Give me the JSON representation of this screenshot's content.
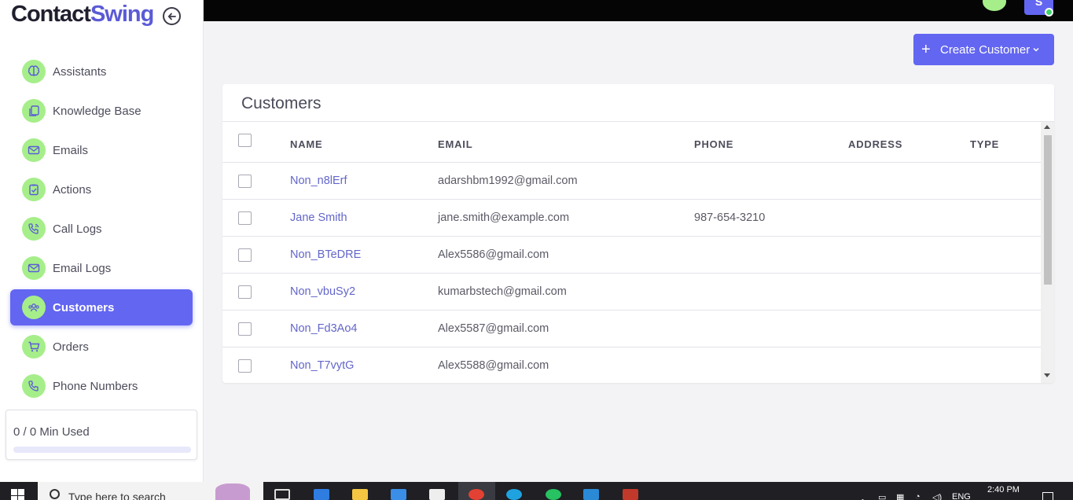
{
  "brand": {
    "part1": "Contact",
    "part2": "Swing"
  },
  "sidebar": {
    "items": [
      {
        "label": "Assistants",
        "icon": "brain-icon",
        "active": false
      },
      {
        "label": "Knowledge Base",
        "icon": "documents-icon",
        "active": false
      },
      {
        "label": "Emails",
        "icon": "mail-icon",
        "active": false
      },
      {
        "label": "Actions",
        "icon": "clipboard-check-icon",
        "active": false
      },
      {
        "label": "Call Logs",
        "icon": "phone-call-icon",
        "active": false
      },
      {
        "label": "Email Logs",
        "icon": "mail-icon",
        "active": false
      },
      {
        "label": "Customers",
        "icon": "users-icon",
        "active": true
      },
      {
        "label": "Orders",
        "icon": "cart-icon",
        "active": false
      },
      {
        "label": "Phone Numbers",
        "icon": "phone-icon",
        "active": false
      }
    ],
    "usage": {
      "text": "0 / 0 Min Used",
      "fraction": 0
    }
  },
  "topbar": {
    "avatar_letter": "S"
  },
  "create_button": {
    "label": "Create Customer"
  },
  "card": {
    "title": "Customers",
    "columns": [
      "NAME",
      "EMAIL",
      "PHONE",
      "ADDRESS",
      "TYPE"
    ],
    "rows": [
      {
        "name": "Non_n8lErf",
        "email": "adarshbm1992@gmail.com",
        "phone": "",
        "address": "",
        "type": ""
      },
      {
        "name": "Jane Smith",
        "email": "jane.smith@example.com",
        "phone": "987-654-3210",
        "address": "",
        "type": ""
      },
      {
        "name": "Non_BTeDRE",
        "email": "Alex5586@gmail.com",
        "phone": "",
        "address": "",
        "type": ""
      },
      {
        "name": "Non_vbuSy2",
        "email": "kumarbstech@gmail.com",
        "phone": "",
        "address": "",
        "type": ""
      },
      {
        "name": "Non_Fd3Ao4",
        "email": "Alex5587@gmail.com",
        "phone": "",
        "address": "",
        "type": ""
      },
      {
        "name": "Non_T7vytG",
        "email": "Alex5588@gmail.com",
        "phone": "",
        "address": "",
        "type": ""
      }
    ]
  },
  "taskbar": {
    "search_placeholder": "Type here to search",
    "language": "ENG",
    "time": "2:40 PM"
  },
  "colors": {
    "accent": "#6366f1",
    "icon_bg": "#a6ee8a"
  }
}
